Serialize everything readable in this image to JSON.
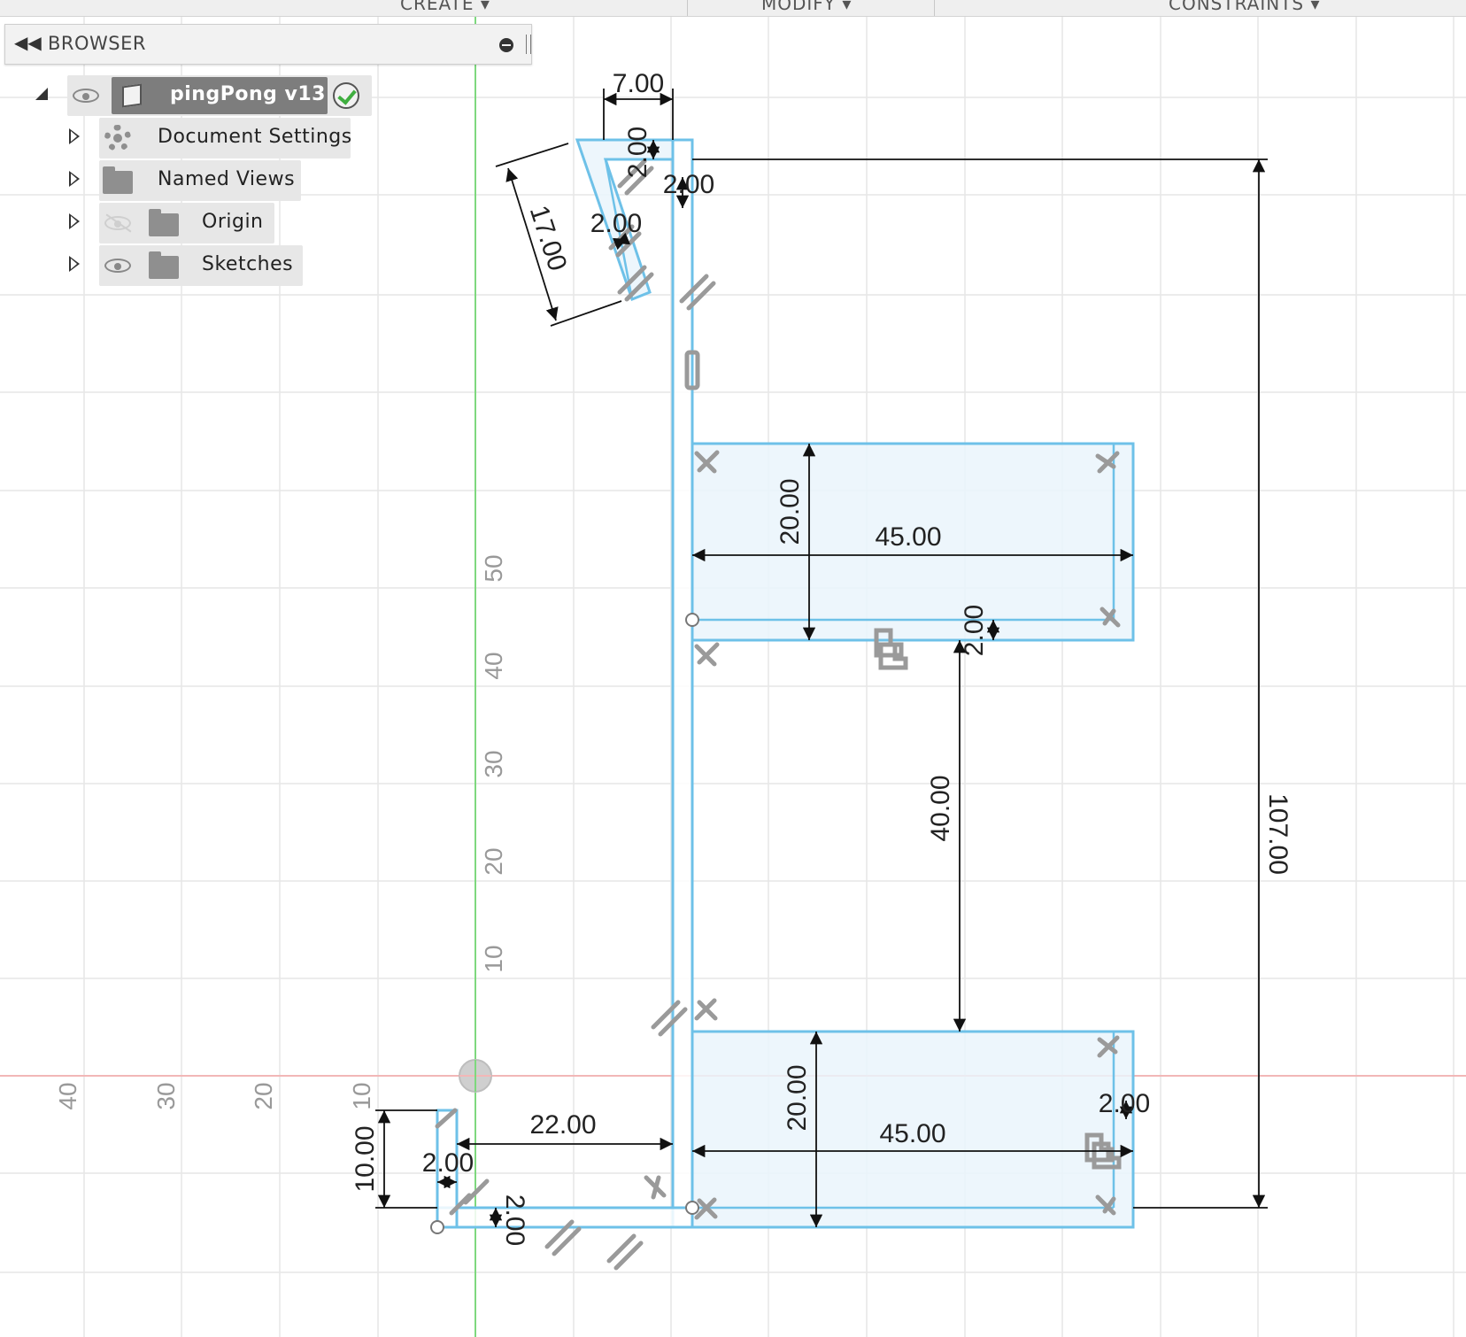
{
  "toolbar": {
    "menus": [
      "CREATE ▾",
      "MODIFY ▾",
      "CONSTRAINTS ▾"
    ]
  },
  "browser": {
    "title": "BROWSER",
    "root": {
      "label": "pingPong v13"
    },
    "items": [
      {
        "label": "Document Settings",
        "icon": "gear-icon"
      },
      {
        "label": "Named Views",
        "icon": "folder-icon"
      },
      {
        "label": "Origin",
        "icon": "folder-icon",
        "visible": false
      },
      {
        "label": "Sketches",
        "icon": "folder-icon",
        "visible": true
      }
    ]
  },
  "axis": {
    "vertical_labels": [
      "50",
      "40",
      "30",
      "20",
      "10"
    ],
    "horizontal_labels": [
      "40",
      "30",
      "20",
      "10"
    ]
  },
  "dimensions": {
    "top_width": "7.00",
    "top_thickness": "2.00",
    "top_gap": "2.00",
    "angled_length": "17.00",
    "angled_thickness": "2.00",
    "upper_shelf_height": "20.00",
    "upper_shelf_width": "45.00",
    "upper_shelf_thickness": "2.00",
    "shelf_spacing": "40.00",
    "lower_shelf_height": "20.00",
    "lower_shelf_width": "45.00",
    "lower_shelf_thickness": "2.00",
    "total_height": "107.00",
    "base_length": "22.00",
    "base_thickness": "2.00",
    "lip_height": "10.00",
    "lip_thickness": "2.00"
  },
  "colors": {
    "profile": "#6ec1e8",
    "profile_fill": "#eaf5fc",
    "grid": "#e6e6e6",
    "y_axis": "#7ed87e",
    "x_axis": "#f2b7b7",
    "dimension": "#111111"
  }
}
